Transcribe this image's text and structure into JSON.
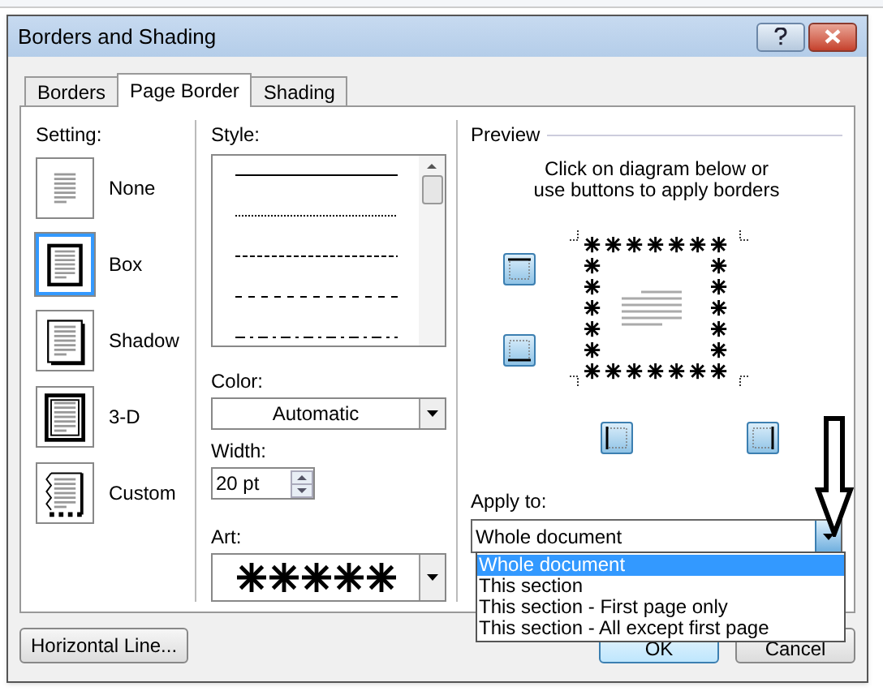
{
  "window": {
    "title": "Borders and Shading"
  },
  "tabs": [
    {
      "label": "Borders",
      "selected": false
    },
    {
      "label": "Page Border",
      "selected": true
    },
    {
      "label": "Shading",
      "selected": false
    }
  ],
  "setting": {
    "label": "Setting:",
    "items": [
      {
        "label": "None",
        "kind": "none",
        "selected": false
      },
      {
        "label": "Box",
        "kind": "box",
        "selected": true
      },
      {
        "label": "Shadow",
        "kind": "shadow",
        "selected": false
      },
      {
        "label": "3-D",
        "kind": "threed",
        "selected": false
      },
      {
        "label": "Custom",
        "kind": "custom",
        "selected": false
      }
    ]
  },
  "style": {
    "label": "Style:",
    "lines": [
      {
        "kind": "solid"
      },
      {
        "kind": "dotted"
      },
      {
        "kind": "dashed"
      },
      {
        "kind": "long-dash"
      },
      {
        "kind": "dash-dot"
      }
    ]
  },
  "color": {
    "label": "Color:",
    "value": "Automatic"
  },
  "width": {
    "label": "Width:",
    "value": "20 pt"
  },
  "art": {
    "label": "Art:"
  },
  "preview": {
    "label": "Preview",
    "instruction": "Click on diagram below or use buttons to apply borders"
  },
  "apply_to": {
    "label": "Apply to:",
    "value": "Whole document",
    "expanded": true,
    "options": [
      {
        "label": "Whole document",
        "selected": true
      },
      {
        "label": "This section",
        "selected": false
      },
      {
        "label": "This section - First page only",
        "selected": false
      },
      {
        "label": "This section - All except first page",
        "selected": false
      }
    ]
  },
  "buttons": {
    "horizontal_line": "Horizontal Line...",
    "ok": "OK",
    "cancel": "Cancel"
  }
}
